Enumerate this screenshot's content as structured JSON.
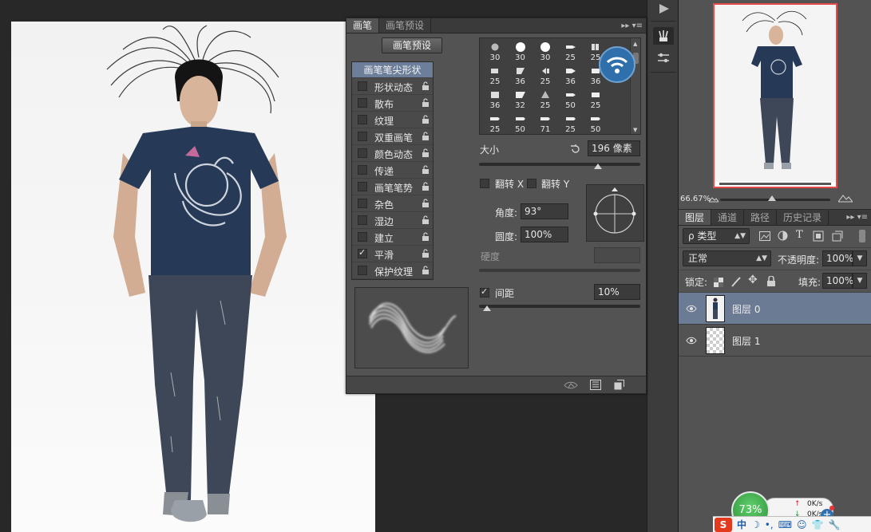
{
  "brush_panel": {
    "tabs": [
      "画笔",
      "画笔预设"
    ],
    "tab_menu": "▸▸ ▾≡",
    "preset_button": "画笔预设",
    "list_header": "画笔笔尖形状",
    "options": [
      {
        "label": "形状动态",
        "checked": false
      },
      {
        "label": "散布",
        "checked": false
      },
      {
        "label": "纹理",
        "checked": false
      },
      {
        "label": "双重画笔",
        "checked": false
      },
      {
        "label": "颜色动态",
        "checked": false
      },
      {
        "label": "传递",
        "checked": false
      },
      {
        "label": "画笔笔势",
        "checked": false
      },
      {
        "label": "杂色",
        "checked": false
      },
      {
        "label": "湿边",
        "checked": false
      },
      {
        "label": "建立",
        "checked": false
      },
      {
        "label": "平滑",
        "checked": true
      },
      {
        "label": "保护纹理",
        "checked": false
      }
    ],
    "tip_rows": [
      [
        "30",
        "30",
        "30",
        "25",
        "25"
      ],
      [
        "25",
        "36",
        "25",
        "36",
        "36"
      ],
      [
        "36",
        "32",
        "25",
        "50",
        "25"
      ],
      [
        "25",
        "50",
        "71",
        "25",
        "50"
      ]
    ],
    "size_label": "大小",
    "size_value": "196 像素",
    "flip_x_label": "翻转 X",
    "flip_y_label": "翻转 Y",
    "angle_label": "角度:",
    "angle_value": "93°",
    "roundness_label": "圆度:",
    "roundness_value": "100%",
    "hardness_label": "硬度",
    "spacing_label": "间距",
    "spacing_value": "10%",
    "spacing_checked": true,
    "size_slider_fraction": 0.74,
    "spacing_slider_fraction": 0.05
  },
  "navigator": {
    "zoom": "66.67%"
  },
  "layers_panel": {
    "tabs": [
      "图层",
      "通道",
      "路径",
      "历史记录"
    ],
    "tab_menu": "▸▸ ▾≡",
    "filter_label": "ρ 类型",
    "blend_mode": "正常",
    "opacity_label": "不透明度:",
    "opacity_value": "100%",
    "lock_label": "锁定:",
    "fill_label": "填充:",
    "fill_value": "100%",
    "layers": [
      {
        "name": "图层 0",
        "selected": true
      },
      {
        "name": "图层 1",
        "selected": false
      }
    ]
  },
  "overlays": {
    "cpu_percent": "73%",
    "net_speed": "0K/s",
    "net_speed2": "0K/s",
    "ime_text": "中"
  },
  "colors": {
    "panel_bg": "#535353",
    "selection": "#6b7b93",
    "nav_frame": "#e34a4a",
    "cpu_green": "#3aa54a"
  }
}
